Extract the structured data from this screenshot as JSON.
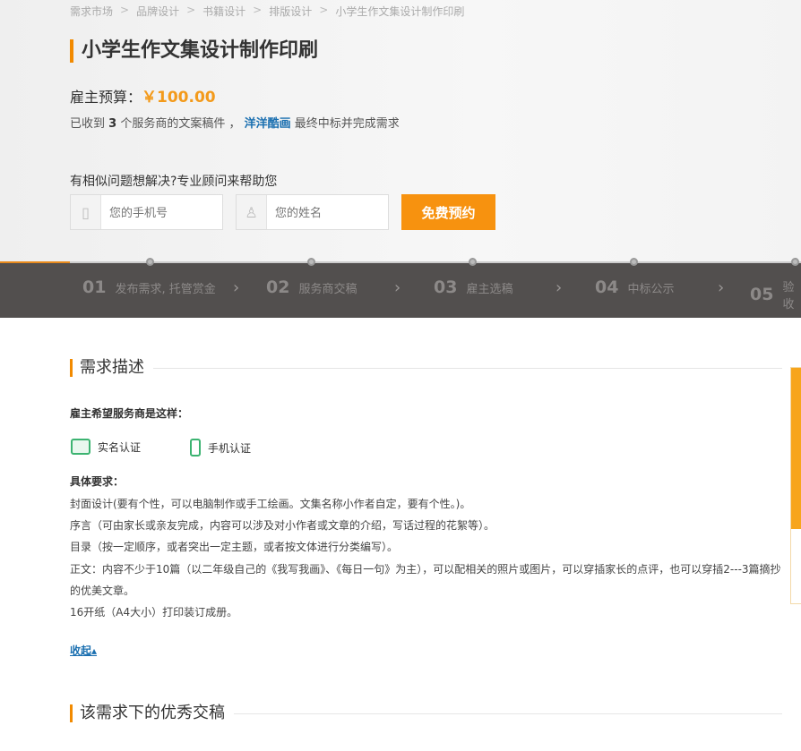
{
  "breadcrumb": [
    "需求市场",
    "品牌设计",
    "书籍设计",
    "排版设计",
    "小学生作文集设计制作印刷"
  ],
  "title": "小学生作文集设计制作印刷",
  "budget": {
    "label": "雇主预算：",
    "amount": "￥100.00"
  },
  "received": {
    "prefix": "已收到",
    "count": "3",
    "middle": "个服务商的文案稿件 ，",
    "winner": "洋洋酷画",
    "suffix": "最终中标并完成需求"
  },
  "consult": {
    "heading": "有相似问题想解决?专业顾问来帮助您",
    "phone_placeholder": "您的手机号",
    "name_placeholder": "您的姓名",
    "button": "免费预约"
  },
  "steps": [
    {
      "num": "01",
      "label": "发布需求, 托管赏金"
    },
    {
      "num": "02",
      "label": "服务商交稿"
    },
    {
      "num": "03",
      "label": "雇主选稿"
    },
    {
      "num": "04",
      "label": "中标公示"
    },
    {
      "num": "05",
      "label": "验收"
    }
  ],
  "description": {
    "heading": "需求描述",
    "hope_label": "雇主希望服务商是这样：",
    "badges": [
      "实名认证",
      "手机认证"
    ],
    "req_label": "具体要求：",
    "lines": [
      "封面设计(要有个性，可以电脑制作或手工绘画。文集名称小作者自定，要有个性。)。",
      "序言（可由家长或亲友完成，内容可以涉及对小作者或文章的介绍，写话过程的花絮等）。",
      "目录（按一定顺序，或者突出一定主题，或者按文体进行分类编写）。",
      "正文：内容不少于10篇（以二年级自己的《我写我画》、《每日一句》为主），可以配相关的照片或图片，可以穿插家长的点评，也可以穿插2---3篇摘抄的优美文章。",
      "16开纸（A4大小）打印装订成册。"
    ],
    "collapse": "收起▴"
  },
  "works": {
    "heading": "该需求下的优秀交稿"
  },
  "colors": {
    "accent": "#f28a00",
    "link": "#1a6fb0",
    "steps_bg": "#524f4e"
  }
}
